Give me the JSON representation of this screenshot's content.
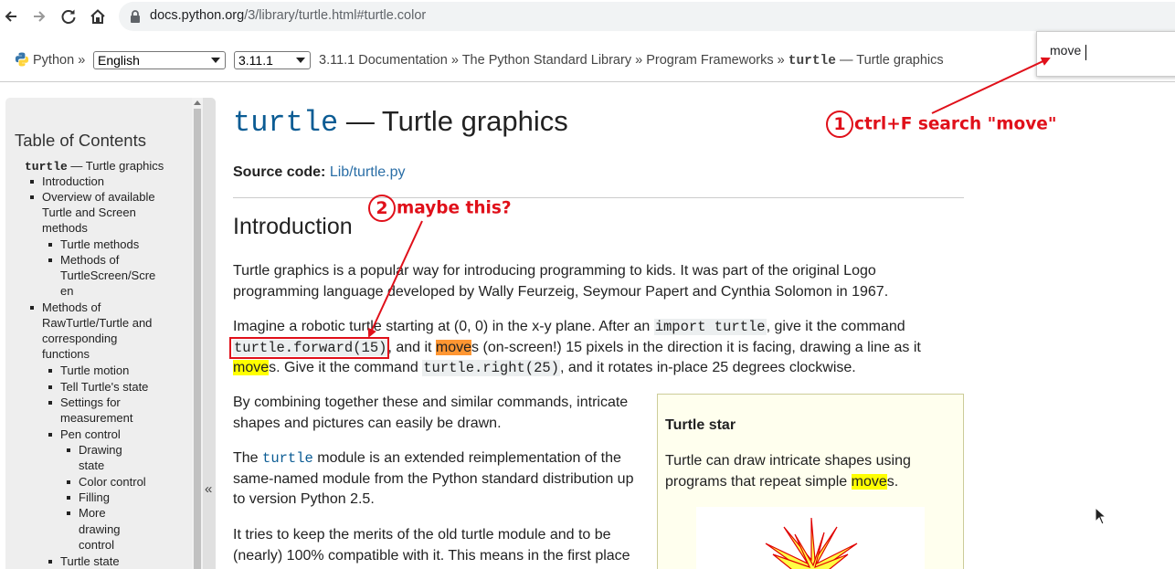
{
  "browser": {
    "url_domain": "docs.python.org",
    "url_path": "/3/library/turtle.html#turtle.color",
    "find_query": "move"
  },
  "related_bar": {
    "python_label": "Python",
    "sep": "»",
    "language_select": "English",
    "version_select": "3.11.1",
    "crumb_docs": "3.11.1 Documentation",
    "crumb_stdlib": "The Python Standard Library",
    "crumb_frameworks": "Program Frameworks",
    "crumb_page_code": "turtle",
    "crumb_page_text": "— Turtle graphics"
  },
  "sidebar": {
    "title": "Table of Contents",
    "collapse_glyph": "«",
    "items": [
      {
        "code": "turtle",
        "text": " — Turtle graphics"
      },
      {
        "text": "Introduction"
      },
      {
        "text": "Overview of available"
      },
      {
        "text": "Turtle and Screen"
      },
      {
        "text": "methods"
      },
      {
        "text": "Turtle methods"
      },
      {
        "text": "Methods of"
      },
      {
        "text": "TurtleScreen/Scre"
      },
      {
        "text": "en"
      },
      {
        "text": "Methods of"
      },
      {
        "text": "RawTurtle/Turtle and"
      },
      {
        "text": "corresponding"
      },
      {
        "text": "functions"
      },
      {
        "text": "Turtle motion"
      },
      {
        "text": "Tell Turtle's state"
      },
      {
        "text": "Settings for"
      },
      {
        "text": "measurement"
      },
      {
        "text": "Pen control"
      },
      {
        "text": "Drawing"
      },
      {
        "text": "state"
      },
      {
        "text": "Color control"
      },
      {
        "text": "Filling"
      },
      {
        "text": "More"
      },
      {
        "text": "drawing"
      },
      {
        "text": "control"
      },
      {
        "text": "Turtle state"
      }
    ]
  },
  "main": {
    "title_code": "turtle",
    "title_text": " — Turtle graphics",
    "source_label": "Source code:",
    "source_link": "Lib/turtle.py",
    "h2": "Introduction",
    "p1_line1": "Turtle graphics is a popular way for introducing programming to kids. It was part of the original Logo",
    "p1_line2": "programming language developed by Wally Feurzeig, Seymour Papert and Cynthia Solomon in 1967.",
    "p2_a": "Imagine a robotic turtle starting at (0, 0) in the x-y plane. After an ",
    "p2_code1": "import turtle",
    "p2_b": ", give it the command",
    "p2_code2": "turtle.forward(15)",
    "p2_c": ", and it ",
    "p2_hl1": "move",
    "p2_d": "s (on-screen!) 15 pixels in the direction it is facing, drawing a line as it",
    "p2_hl2": "move",
    "p2_e": "s. Give it the command ",
    "p2_code3": "turtle.right(25)",
    "p2_f": ", and it rotates in-place 25 degrees clockwise.",
    "p3_line1": "By combining together these and similar commands, intricate",
    "p3_line2": "shapes and pictures can easily be drawn.",
    "p4_a": "The ",
    "p4_code": "turtle",
    "p4_b": " module is an extended reimplementation of the",
    "p4_line2": "same-named module from the Python standard distribution up",
    "p4_line3": "to version Python 2.5.",
    "p5_line1": "It tries to keep the merits of the old turtle module and to be",
    "p5_line2": "(nearly) 100% compatible with it. This means in the first place",
    "star_title": "Turtle star",
    "star_line1": "Turtle can draw intricate shapes using",
    "star_a": "programs that repeat simple ",
    "star_hl": "move",
    "star_b": "s."
  },
  "annotations": {
    "a1_num": "1",
    "a1_text": "ctrl+F search \"move\"",
    "a2_num": "2",
    "a2_text": "maybe this?"
  },
  "colors": {
    "annotation_red": "#e0101a",
    "current_match": "#ff9632",
    "match": "#ffff00",
    "code_blue": "#0b5c94",
    "link_blue": "#2a6ea6"
  }
}
